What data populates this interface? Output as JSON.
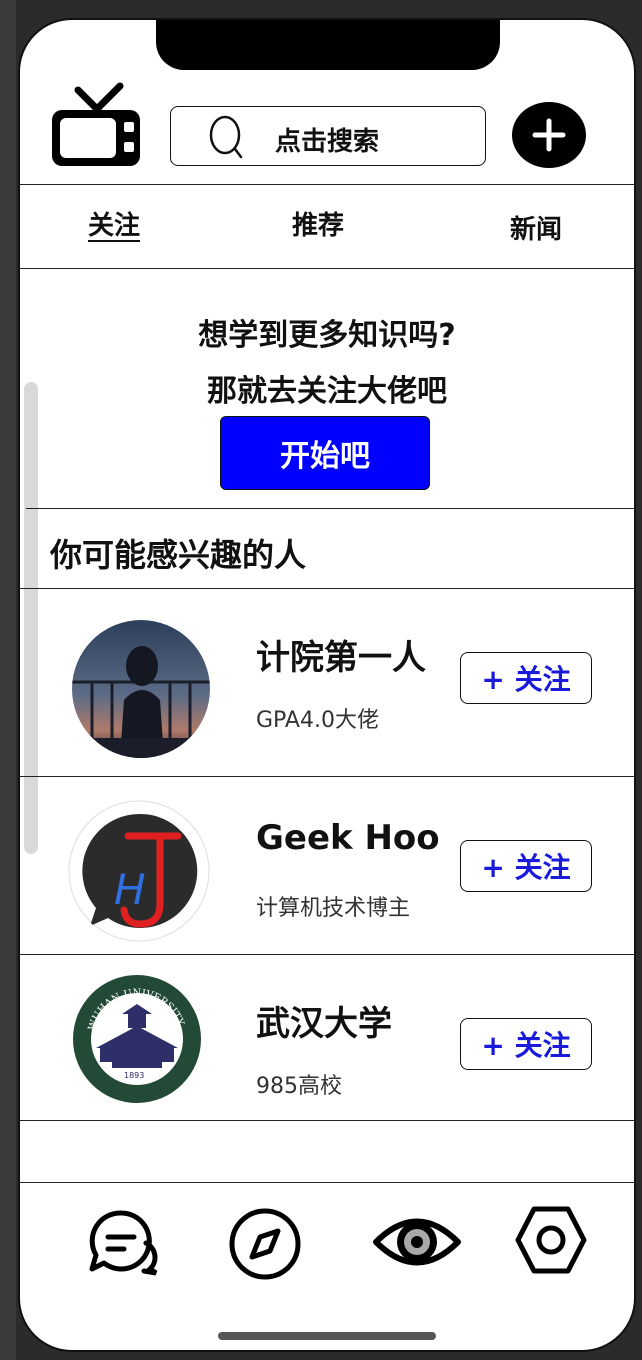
{
  "header": {
    "search_placeholder": "点击搜索"
  },
  "tabs": [
    {
      "label": "关注",
      "active": true
    },
    {
      "label": "推荐",
      "active": false
    },
    {
      "label": "新闻",
      "active": false
    }
  ],
  "promo": {
    "line1": "想学到更多知识吗?",
    "line2": "那就去关注大佬吧",
    "button_label": "开始吧"
  },
  "suggestions": {
    "title": "你可能感兴趣的人",
    "follow_label": "+ 关注",
    "people": [
      {
        "name": "计院第一人",
        "desc": "GPA4.0大佬",
        "avatar": "girl-balcony-photo"
      },
      {
        "name": "Geek Hoo",
        "desc": "计算机技术博主",
        "avatar": "hj-logo"
      },
      {
        "name": "武汉大学",
        "desc": "985高校",
        "avatar": "wuhan-university-emblem",
        "emblem_text": "WUHAN UNIVERSITY",
        "emblem_year": "1893"
      }
    ]
  },
  "bottom_nav": [
    {
      "icon": "chat-icon"
    },
    {
      "icon": "compass-icon"
    },
    {
      "icon": "eye-icon"
    },
    {
      "icon": "settings-hexagon-icon"
    }
  ],
  "colors": {
    "accent": "#0000ff",
    "follow_text": "#1a1adb"
  }
}
